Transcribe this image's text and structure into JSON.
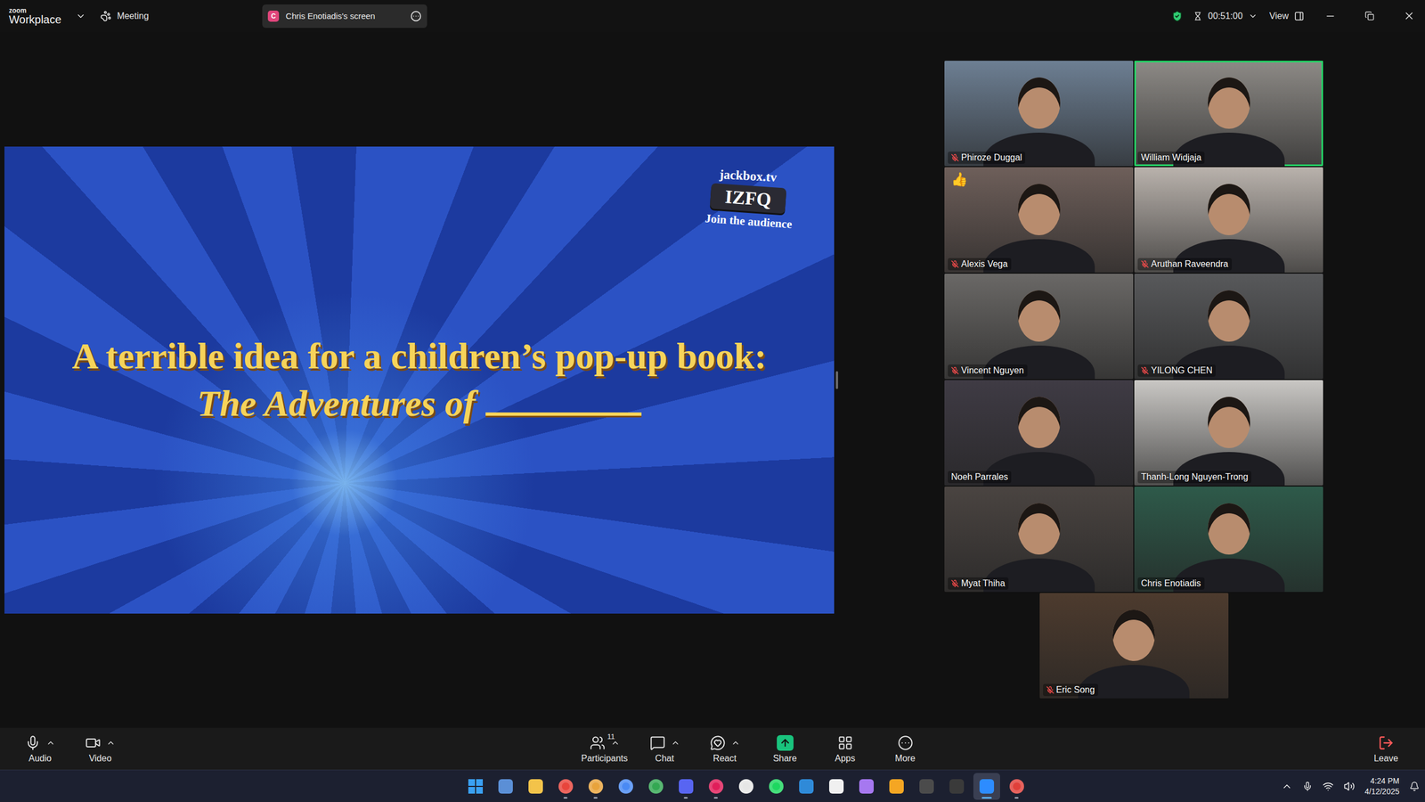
{
  "window": {
    "app": "zoom",
    "product": "Workplace",
    "meeting_label": "Meeting",
    "share_pill_avatar": "C",
    "share_pill": "Chris Enotiadis's screen",
    "secure": true,
    "timer": "00:51:00",
    "view_label": "View"
  },
  "shared_screen": {
    "room_site": "jackbox.tv",
    "room_code": "IZFQ",
    "room_hint": "Join the audience",
    "prompt": "A terrible idea for a children’s pop-up book: ",
    "prompt_italic": "The Adventures of"
  },
  "participants": [
    {
      "name": "Phiroze Duggal",
      "muted": true,
      "speaking": false,
      "reaction": null,
      "color": "#6d7f93"
    },
    {
      "name": "William Widjaja",
      "muted": false,
      "speaking": true,
      "reaction": null,
      "color": "#8d8a86"
    },
    {
      "name": "Alexis Vega",
      "muted": true,
      "speaking": false,
      "reaction": "👍",
      "color": "#6e5f5a"
    },
    {
      "name": "Aruthan Raveendra",
      "muted": true,
      "speaking": false,
      "reaction": null,
      "color": "#b9b2ac"
    },
    {
      "name": "Vincent Nguyen",
      "muted": true,
      "speaking": false,
      "reaction": null,
      "color": "#6a6866"
    },
    {
      "name": "YILONG CHEN",
      "muted": true,
      "speaking": false,
      "reaction": null,
      "color": "#58595b"
    },
    {
      "name": "Noeh Parrales",
      "muted": false,
      "speaking": false,
      "reaction": null,
      "color": "#3f3b44"
    },
    {
      "name": "Thanh-Long Nguyen-Trong",
      "muted": false,
      "speaking": false,
      "reaction": null,
      "color": "#c9c7c4"
    },
    {
      "name": "Myat Thiha",
      "muted": true,
      "speaking": false,
      "reaction": null,
      "color": "#4a4441"
    },
    {
      "name": "Chris Enotiadis",
      "muted": false,
      "speaking": false,
      "reaction": null,
      "color": "#2e5a4a"
    },
    {
      "name": "Eric Song",
      "muted": true,
      "speaking": false,
      "reaction": null,
      "color": "#4d3b2e"
    }
  ],
  "toolbar": {
    "left": [
      {
        "label": "Audio",
        "kind": "audio",
        "menu": true
      },
      {
        "label": "Video",
        "kind": "video",
        "menu": true
      }
    ],
    "center": [
      {
        "label": "Participants",
        "kind": "participants",
        "menu": true,
        "count": "11"
      },
      {
        "label": "Chat",
        "kind": "chat",
        "menu": true,
        "count": null
      },
      {
        "label": "React",
        "kind": "react",
        "menu": true,
        "count": null
      },
      {
        "label": "Share",
        "kind": "share",
        "menu": false,
        "count": null
      },
      {
        "label": "Apps",
        "kind": "apps",
        "menu": false,
        "count": null
      },
      {
        "label": "More",
        "kind": "more",
        "menu": false,
        "count": null
      }
    ],
    "leave": "Leave"
  },
  "taskbar": {
    "time": "4:24 PM",
    "date": "4/12/2025",
    "apps": [
      {
        "kind": "windows",
        "color": "#3aa0f3",
        "running": false,
        "selected": false
      },
      {
        "kind": "tile",
        "color": "#5b8fd6",
        "running": false,
        "selected": false
      },
      {
        "kind": "tile",
        "color": "#f3c34a",
        "running": false,
        "selected": false
      },
      {
        "kind": "circle",
        "color": "#e8453c",
        "running": true,
        "selected": false
      },
      {
        "kind": "circle",
        "color": "#e8a33c",
        "running": true,
        "selected": false
      },
      {
        "kind": "circle",
        "color": "#4a8af4",
        "running": false,
        "selected": false
      },
      {
        "kind": "circle",
        "color": "#34a853",
        "running": false,
        "selected": false
      },
      {
        "kind": "tile",
        "color": "#5865f2",
        "running": true,
        "selected": false
      },
      {
        "kind": "circle",
        "color": "#e01e5a",
        "running": true,
        "selected": false
      },
      {
        "kind": "circle",
        "color": "#e6e6e6",
        "running": false,
        "selected": false
      },
      {
        "kind": "circle",
        "color": "#1ed760",
        "running": false,
        "selected": false
      },
      {
        "kind": "tile",
        "color": "#2f8ad8",
        "running": false,
        "selected": false
      },
      {
        "kind": "tile",
        "color": "#f0f0f0",
        "running": false,
        "selected": false
      },
      {
        "kind": "tile",
        "color": "#a678f0",
        "running": false,
        "selected": false
      },
      {
        "kind": "tile",
        "color": "#f5a623",
        "running": false,
        "selected": false
      },
      {
        "kind": "tile",
        "color": "#4b4b4b",
        "running": false,
        "selected": false
      },
      {
        "kind": "tile",
        "color": "#3a3a3a",
        "running": false,
        "selected": false
      },
      {
        "kind": "tile",
        "color": "#2d8cff",
        "running": true,
        "selected": true
      },
      {
        "kind": "circle",
        "color": "#e0403a",
        "running": true,
        "selected": false
      }
    ]
  }
}
